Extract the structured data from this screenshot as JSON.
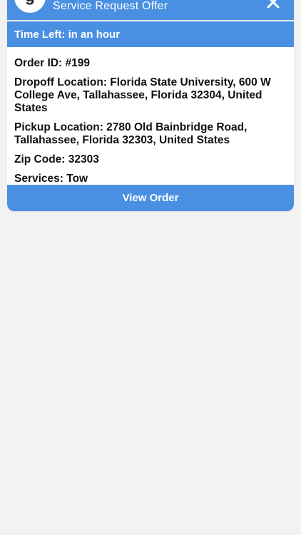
{
  "header": {
    "avatar_glyph": "g",
    "title": "Service Request Offer",
    "close_icon": "close-icon"
  },
  "offer": {
    "time_left": "Time Left: in an hour",
    "order_id": "Order ID: #199",
    "dropoff": "Dropoff Location: Florida State University, 600 W College Ave, Tallahassee, Florida 32304, United States",
    "pickup": "Pickup Location: 2780 Old Bainbridge Road, Tallahassee, Florida 32303, United States",
    "zip": "Zip Code: 32303",
    "services": "Services: Tow"
  },
  "actions": {
    "view_order_label": "View Order"
  },
  "colors": {
    "accent": "#4a90e2",
    "background": "#f2f2f2",
    "card": "#ffffff"
  }
}
